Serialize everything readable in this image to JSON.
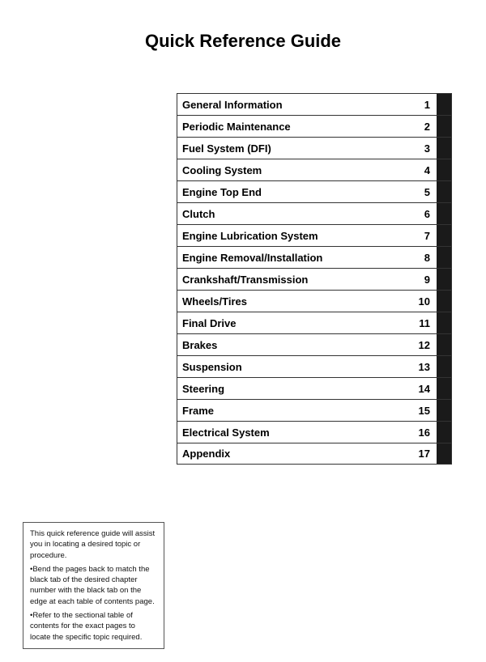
{
  "page": {
    "title": "Quick Reference Guide",
    "toc_items": [
      {
        "label": "General Information",
        "number": "1"
      },
      {
        "label": "Periodic Maintenance",
        "number": "2"
      },
      {
        "label": "Fuel System (DFI)",
        "number": "3"
      },
      {
        "label": "Cooling System",
        "number": "4"
      },
      {
        "label": "Engine Top End",
        "number": "5"
      },
      {
        "label": "Clutch",
        "number": "6"
      },
      {
        "label": "Engine Lubrication System",
        "number": "7"
      },
      {
        "label": "Engine Removal/Installation",
        "number": "8"
      },
      {
        "label": "Crankshaft/Transmission",
        "number": "9"
      },
      {
        "label": "Wheels/Tires",
        "number": "10"
      },
      {
        "label": "Final Drive",
        "number": "11"
      },
      {
        "label": "Brakes",
        "number": "12"
      },
      {
        "label": "Suspension",
        "number": "13"
      },
      {
        "label": "Steering",
        "number": "14"
      },
      {
        "label": "Frame",
        "number": "15"
      },
      {
        "label": "Electrical System",
        "number": "16"
      },
      {
        "label": "Appendix",
        "number": "17"
      }
    ],
    "note": {
      "lines": [
        "This quick reference guide will assist you in locating a desired topic or procedure.",
        "•Bend the pages back to match the black tab of the desired chapter number with the black tab on the edge at each table of contents page.",
        "•Refer to the sectional table of contents for the exact pages to locate the specific topic required."
      ]
    }
  }
}
